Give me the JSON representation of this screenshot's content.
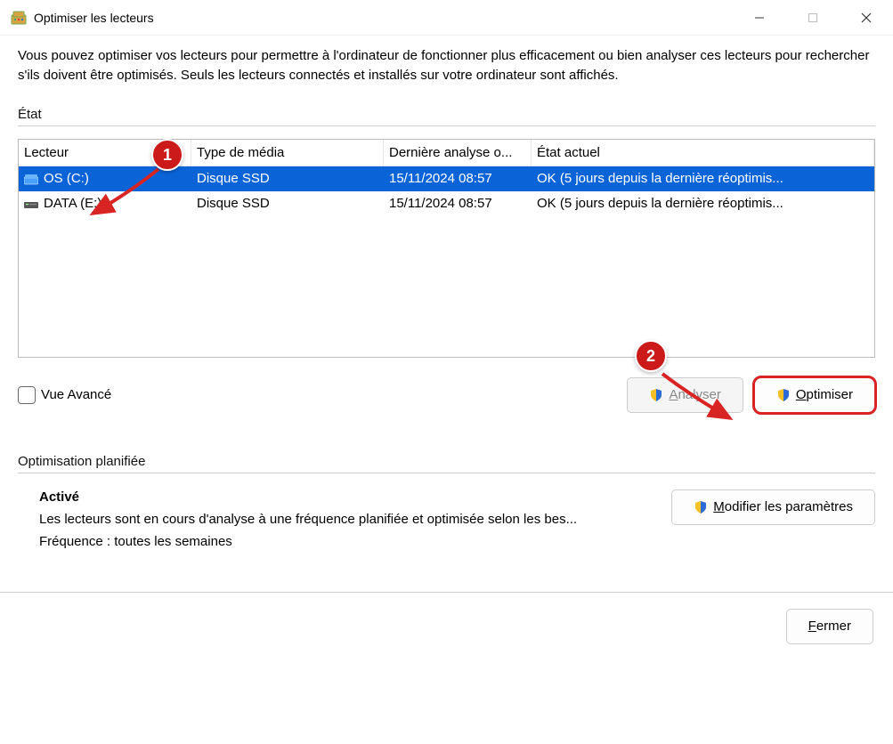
{
  "window": {
    "title": "Optimiser les lecteurs"
  },
  "intro": "Vous pouvez optimiser vos lecteurs pour permettre à l'ordinateur de fonctionner plus efficacement ou bien analyser ces lecteurs pour rechercher s'ils doivent être optimisés. Seuls les lecteurs connectés et installés sur votre ordinateur sont affichés.",
  "status_section": {
    "label": "État",
    "columns": {
      "drive": "Lecteur",
      "media": "Type de média",
      "last": "Dernière analyse o...",
      "current": "État actuel"
    },
    "rows": [
      {
        "selected": true,
        "name": "OS (C:)",
        "media": "Disque SSD",
        "last": "15/11/2024 08:57",
        "state": "OK (5 jours depuis la dernière réoptimis..."
      },
      {
        "selected": false,
        "name": "DATA (E:)",
        "media": "Disque SSD",
        "last": "15/11/2024 08:57",
        "state": "OK (5 jours depuis la dernière réoptimis..."
      }
    ]
  },
  "advanced_view_label": "Vue Avancé",
  "buttons": {
    "analyze": "Analyser",
    "optimize": "Optimiser",
    "modify": "Modifier les paramètres",
    "close": "Fermer"
  },
  "scheduled": {
    "label": "Optimisation planifiée",
    "on_label": "Activé",
    "line1": "Les lecteurs sont en cours d'analyse à une fréquence planifiée et optimisée selon les bes...",
    "line2": "Fréquence : toutes les semaines"
  },
  "annotations": {
    "1": "1",
    "2": "2"
  }
}
